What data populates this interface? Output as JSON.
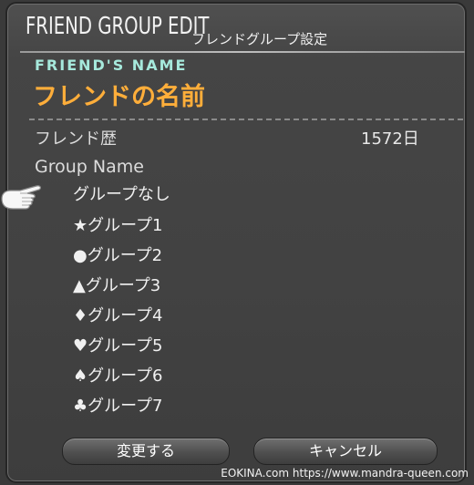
{
  "dialog": {
    "title_en": "FRIEND GROUP EDIT",
    "title_ja": "フレンドグループ設定",
    "friends_name_label": "FRIEND'S NAME",
    "friend_name": "フレンドの名前",
    "history_label": "フレンド歴",
    "history_value": "1572日",
    "group_name_label": "Group Name",
    "groups": [
      {
        "label": "グループなし",
        "icon": "none",
        "selected": true
      },
      {
        "label": "★グループ1",
        "icon": "star-icon",
        "selected": false
      },
      {
        "label": "●グループ2",
        "icon": "circle-icon",
        "selected": false
      },
      {
        "label": "▲グループ3",
        "icon": "triangle-icon",
        "selected": false
      },
      {
        "label": "♦グループ4",
        "icon": "diamond-icon",
        "selected": false
      },
      {
        "label": "♥グループ5",
        "icon": "heart-icon",
        "selected": false
      },
      {
        "label": "♠グループ6",
        "icon": "spade-icon",
        "selected": false
      },
      {
        "label": "♣グループ7",
        "icon": "club-icon",
        "selected": false
      }
    ],
    "buttons": {
      "confirm": "変更する",
      "cancel": "キャンセル"
    }
  },
  "watermark": "EOKINA.com  https://www.mandra-queen.com",
  "colors": {
    "friend_name": "#ffae3a",
    "friends_name_label": "#a6e9dc",
    "selected_highlight": "#c4965c"
  }
}
